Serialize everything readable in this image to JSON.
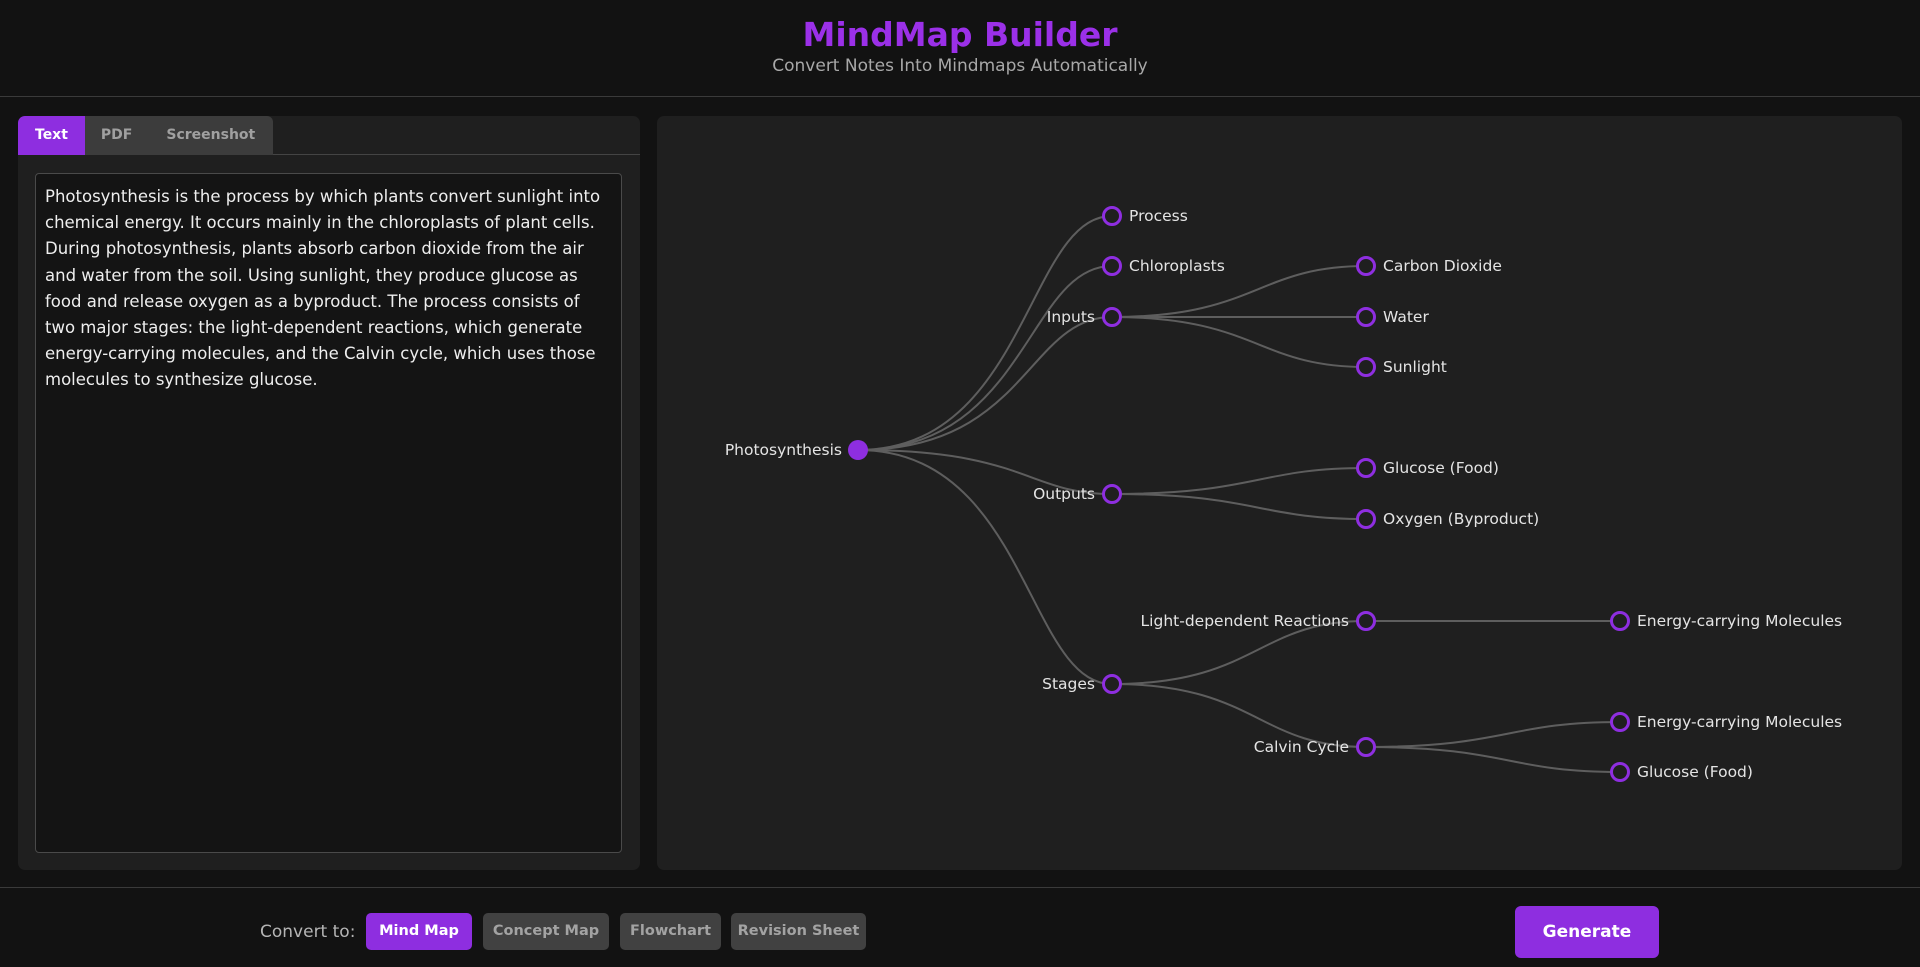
{
  "header": {
    "title": "MindMap Builder",
    "subtitle": "Convert Notes Into Mindmaps Automatically"
  },
  "input_tabs": [
    "Text",
    "PDF",
    "Screenshot"
  ],
  "active_input_tab": "Text",
  "notes_text": "Photosynthesis is the process by which plants convert sunlight into chemical energy. It occurs mainly in the chloroplasts of plant cells. During photosynthesis, plants absorb carbon dioxide from the air and water from the soil. Using sunlight, they produce glucose as food and release oxygen as a byproduct. The process consists of two major stages: the light-dependent reactions, which generate energy-carrying molecules, and the Calvin cycle, which uses those molecules to synthesize glucose.",
  "mindmap": {
    "root": "Photosynthesis",
    "branches": {
      "process": "Process",
      "chloroplasts": "Chloroplasts",
      "inputs": "Inputs",
      "carbon_dioxide": "Carbon Dioxide",
      "water": "Water",
      "sunlight": "Sunlight",
      "outputs": "Outputs",
      "glucose": "Glucose (Food)",
      "oxygen": "Oxygen (Byproduct)",
      "stages": "Stages",
      "light_reactions": "Light-dependent Reactions",
      "energy_molecules_1": "Energy-carrying Molecules",
      "calvin_cycle": "Calvin Cycle",
      "energy_molecules_2": "Energy-carrying Molecules",
      "glucose_2": "Glucose (Food)"
    },
    "colors": {
      "accent": "#8e2ee0",
      "edge": "#5e5e5e",
      "node_fill": "#1f1f1f"
    }
  },
  "footer": {
    "convert_label": "Convert to:",
    "formats": [
      "Mind Map",
      "Concept Map",
      "Flowchart",
      "Revision Sheet"
    ],
    "active_format": "Mind Map",
    "generate_label": "Generate"
  }
}
